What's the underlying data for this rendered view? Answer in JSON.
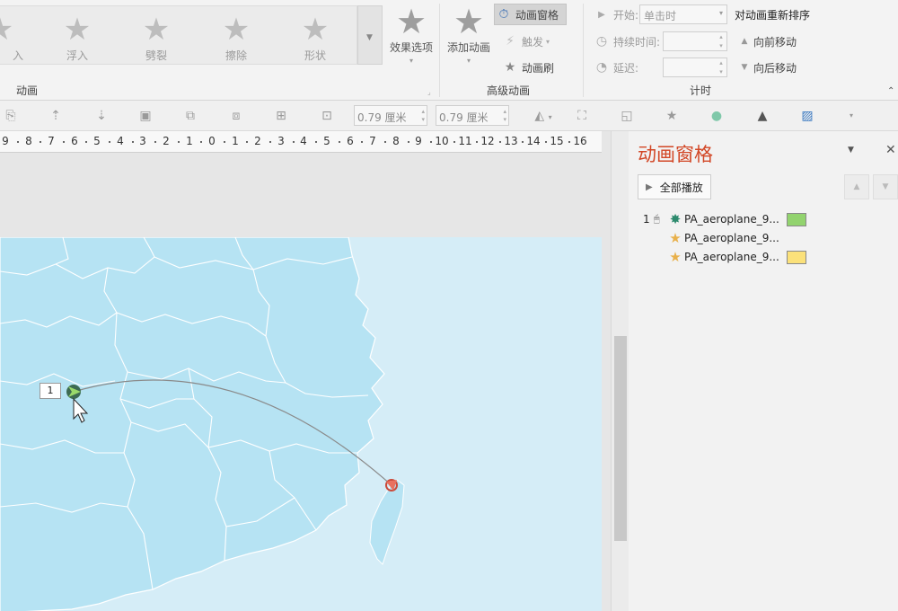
{
  "ribbon": {
    "gallery": [
      {
        "label": "入",
        "icon": "star-icon"
      },
      {
        "label": "浮入",
        "icon": "star-float-icon"
      },
      {
        "label": "劈裂",
        "icon": "star-split-icon"
      },
      {
        "label": "擦除",
        "icon": "star-wipe-icon"
      },
      {
        "label": "形状",
        "icon": "star-shape-icon"
      }
    ],
    "effect_options": "效果选项",
    "group_animation": "动画",
    "add_animation": "添加动画",
    "animation_pane_btn": "动画窗格",
    "trigger": "触发",
    "animation_painter": "动画刷",
    "group_advanced": "高级动画",
    "start_label": "开始:",
    "start_value": "单击时",
    "duration_label": "持续时间:",
    "delay_label": "延迟:",
    "reorder_title": "对动画重新排序",
    "move_earlier": "向前移动",
    "move_later": "向后移动",
    "group_timing": "计时"
  },
  "toolbar": {
    "height_value": "0.79 厘米",
    "width_value": "0.79 厘米"
  },
  "ruler": {
    "labels": [
      "9",
      "8",
      "7",
      "6",
      "5",
      "4",
      "3",
      "2",
      "1",
      "0",
      "1",
      "2",
      "3",
      "4",
      "5",
      "6",
      "7",
      "8",
      "9",
      "10",
      "11",
      "12",
      "13",
      "14",
      "15",
      "16"
    ]
  },
  "slide": {
    "tag_label": "1"
  },
  "pane": {
    "title": "动画窗格",
    "play_all": "全部播放",
    "items": [
      {
        "index": "1",
        "name": "PA_aeroplane_9...",
        "color": "#92d36e",
        "effect_color": "#2e8b6e"
      },
      {
        "index": "",
        "name": "PA_aeroplane_9...",
        "color": "",
        "effect_color": "#e8b04a"
      },
      {
        "index": "",
        "name": "PA_aeroplane_9...",
        "color": "#fbe17a",
        "effect_color": "#e8b04a"
      }
    ]
  },
  "colors": {
    "accent": "#d24726",
    "sea": "#d5edf7",
    "land": "#b6e3f3"
  }
}
